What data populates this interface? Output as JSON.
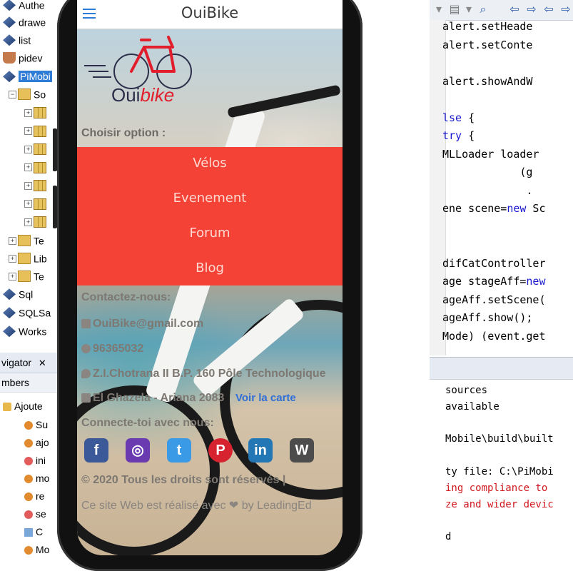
{
  "tree": {
    "items": [
      {
        "label": "Authe",
        "icon": "project-icon"
      },
      {
        "label": "drawe",
        "icon": "project-icon"
      },
      {
        "label": "list",
        "icon": "project-icon"
      },
      {
        "label": "pidev",
        "icon": "java-cup-icon"
      },
      {
        "label": "PiMobi",
        "icon": "project-icon",
        "selected": true
      },
      {
        "label": "So",
        "icon": "folder-icon"
      },
      {
        "label": "Te",
        "icon": "folder-icon"
      },
      {
        "label": "Lib",
        "icon": "library-icon"
      },
      {
        "label": "Te",
        "icon": "library-icon"
      },
      {
        "label": "Sql",
        "icon": "project-icon"
      },
      {
        "label": "SQLSa",
        "icon": "project-icon"
      },
      {
        "label": "Works",
        "icon": "project-icon"
      }
    ]
  },
  "navigator": {
    "title": "vigator",
    "close": "✕",
    "members": "mbers",
    "class_item": "Ajoute",
    "items": [
      "Su",
      "ajo",
      "ini",
      "mo",
      "re",
      "se",
      "C",
      "Mo"
    ]
  },
  "editor": {
    "code_lines": [
      "alert.setHeade",
      "alert.setConte",
      "",
      "alert.showAndW",
      "",
      "lse {",
      "try {",
      "MLLoader loader",
      "            (g",
      "             .",
      "ene scene=new Sc",
      "",
      "",
      "difCatController",
      "age stageAff=new",
      "ageAff.setScene(",
      "ageAff.show();",
      "Mode) (event.get"
    ],
    "output_lines": [
      {
        "text": "sources",
        "error": false
      },
      {
        "text": "available",
        "error": false
      },
      {
        "text": "",
        "error": false
      },
      {
        "text": "Mobile\\build\\built",
        "error": false
      },
      {
        "text": "",
        "error": false
      },
      {
        "text": "ty file: C:\\PiMobi",
        "error": false
      },
      {
        "text": "ing compliance to",
        "error": true
      },
      {
        "text": "ze and wider devic",
        "error": true
      },
      {
        "text": "",
        "error": false
      },
      {
        "text": "d",
        "error": false
      }
    ]
  },
  "app": {
    "title": "OuiBike",
    "logo": {
      "oui": "Oui",
      "bike": "bike"
    },
    "choose_label": "Choisir option :",
    "menu": [
      "Vélos",
      "Evenement",
      "Forum",
      "Blog"
    ],
    "contact_title": "Contactez-nous:",
    "email": "OuiBike@gmail.com",
    "phone": "96365032",
    "address1": "Z.I.Chotrana II B.P. 160 Pôle Technologique",
    "address2": "El Ghazela - Ariana 2083",
    "map_link": "Voir la carte",
    "connect_title": "Connecte-toi avec nous:",
    "social": [
      {
        "name": "facebook-icon",
        "glyph": "f",
        "color": "#3b5998"
      },
      {
        "name": "instagram-icon",
        "glyph": "◎",
        "color": "#6a3ab0"
      },
      {
        "name": "twitter-icon",
        "glyph": "t",
        "color": "#3b9ae6"
      },
      {
        "name": "pinterest-icon",
        "glyph": "P",
        "color": "#d7232f"
      },
      {
        "name": "linkedin-icon",
        "glyph": "in",
        "color": "#2477b5"
      },
      {
        "name": "wordpress-icon",
        "glyph": "W",
        "color": "#4c4c4c"
      }
    ],
    "copyright": "© 2020 Tous les droits sont réservés |",
    "made_with": "Ce site Web est réalisé avec ❤ by LeadingEd"
  }
}
